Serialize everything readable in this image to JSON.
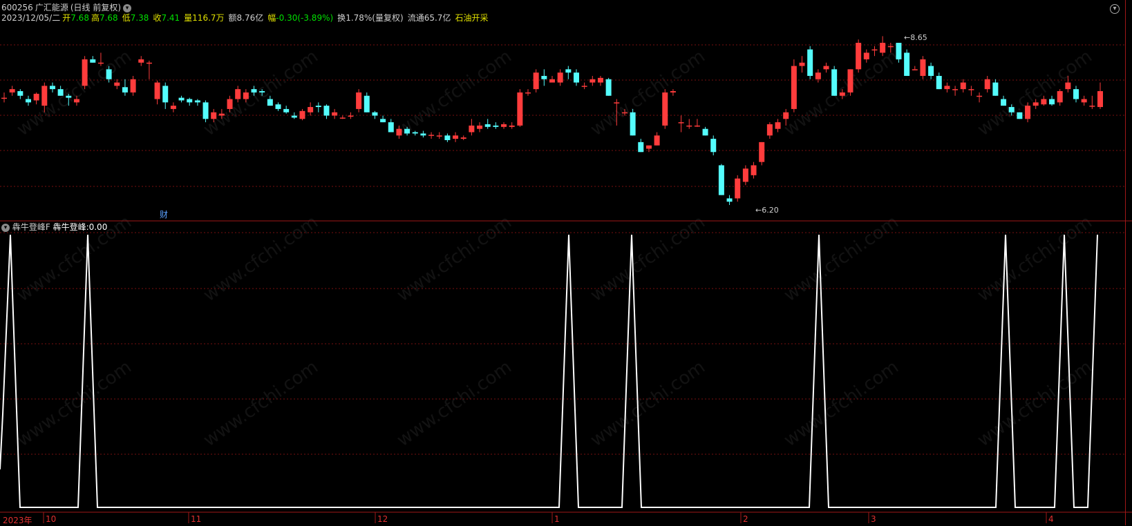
{
  "header": {
    "stock_code": "600256",
    "stock_name": "广汇能源",
    "period_label": "(日线 前复权)",
    "date": "2023/12/05/二",
    "open_label": "开",
    "open": "7.68",
    "high_label": "高",
    "high": "7.68",
    "low_label": "低",
    "low": "7.38",
    "close_label": "收",
    "close": "7.41",
    "volume_label": "量",
    "volume": "116.7万",
    "amount_label": "额",
    "amount": "8.76亿",
    "change_label": "幅",
    "change": "-0.30(-3.89%)",
    "turnover_label": "换",
    "turnover": "1.78%(量复权)",
    "float_label": "流通",
    "float_value": "65.7亿",
    "sector": "石油开采"
  },
  "markers": {
    "high_price": "8.65",
    "low_price": "6.20",
    "finance_tag": "财"
  },
  "indicator": {
    "name": "犇牛登峰F",
    "value_label": "犇牛登峰:",
    "value": "0.00"
  },
  "xaxis": {
    "year": "2023年",
    "months": [
      "10",
      "11",
      "12",
      "1",
      "2",
      "3",
      "4"
    ]
  },
  "watermark": "www.cfchi.com",
  "colors": {
    "up": "#ff3c3c",
    "down": "#54fcfc",
    "grid": "#7a1010",
    "indicator_line": "#ffffff"
  },
  "chart_data": [
    {
      "type": "candlestick",
      "title": "",
      "ylim": [
        6.0,
        9.0
      ],
      "candles": [
        [
          7.82,
          7.9,
          7.75,
          7.82
        ],
        [
          7.9,
          8.0,
          7.85,
          7.95
        ],
        [
          7.92,
          7.95,
          7.8,
          7.85
        ],
        [
          7.8,
          7.85,
          7.7,
          7.75
        ],
        [
          7.78,
          7.9,
          7.72,
          7.88
        ],
        [
          7.7,
          8.05,
          7.6,
          8.0
        ],
        [
          8.0,
          8.05,
          7.9,
          7.95
        ],
        [
          7.95,
          8.0,
          7.85,
          7.85
        ],
        [
          7.85,
          7.88,
          7.7,
          7.82
        ],
        [
          7.75,
          7.85,
          7.7,
          7.8
        ],
        [
          8.0,
          8.45,
          7.95,
          8.4
        ],
        [
          8.4,
          8.45,
          8.35,
          8.35
        ],
        [
          8.35,
          8.5,
          8.3,
          8.35
        ],
        [
          8.25,
          8.3,
          8.05,
          8.1
        ],
        [
          8.0,
          8.1,
          7.95,
          8.05
        ],
        [
          7.98,
          8.1,
          7.85,
          7.9
        ],
        [
          7.9,
          8.15,
          7.85,
          8.1
        ],
        [
          8.35,
          8.45,
          8.3,
          8.4
        ],
        [
          8.35,
          8.38,
          8.1,
          8.35
        ],
        [
          7.8,
          8.08,
          7.72,
          8.05
        ],
        [
          8.0,
          8.05,
          7.65,
          7.75
        ],
        [
          7.65,
          7.75,
          7.6,
          7.7
        ],
        [
          7.82,
          7.85,
          7.75,
          7.78
        ],
        [
          7.8,
          7.82,
          7.7,
          7.75
        ],
        [
          7.78,
          7.8,
          7.7,
          7.75
        ],
        [
          7.75,
          7.78,
          7.45,
          7.5
        ],
        [
          7.5,
          7.65,
          7.45,
          7.6
        ],
        [
          7.55,
          7.65,
          7.5,
          7.58
        ],
        [
          7.65,
          7.85,
          7.6,
          7.8
        ],
        [
          7.8,
          8.0,
          7.75,
          7.95
        ],
        [
          7.8,
          7.95,
          7.75,
          7.9
        ],
        [
          7.95,
          8.0,
          7.85,
          7.9
        ],
        [
          7.92,
          7.95,
          7.85,
          7.9
        ],
        [
          7.8,
          7.85,
          7.7,
          7.7
        ],
        [
          7.72,
          7.75,
          7.62,
          7.65
        ],
        [
          7.65,
          7.7,
          7.58,
          7.6
        ],
        [
          7.55,
          7.6,
          7.5,
          7.52
        ],
        [
          7.5,
          7.65,
          7.48,
          7.62
        ],
        [
          7.6,
          7.75,
          7.55,
          7.68
        ],
        [
          7.7,
          7.75,
          7.6,
          7.68
        ],
        [
          7.7,
          7.72,
          7.5,
          7.55
        ],
        [
          7.55,
          7.65,
          7.5,
          7.6
        ],
        [
          7.52,
          7.55,
          7.5,
          7.52
        ],
        [
          7.55,
          7.6,
          7.5,
          7.55
        ],
        [
          7.65,
          7.95,
          7.6,
          7.9
        ],
        [
          7.85,
          7.9,
          7.6,
          7.6
        ],
        [
          7.6,
          7.62,
          7.5,
          7.55
        ],
        [
          7.5,
          7.55,
          7.45,
          7.45
        ],
        [
          7.45,
          7.5,
          7.3,
          7.3
        ],
        [
          7.25,
          7.4,
          7.2,
          7.35
        ],
        [
          7.35,
          7.38,
          7.25,
          7.28
        ],
        [
          7.3,
          7.32,
          7.25,
          7.28
        ],
        [
          7.28,
          7.32,
          7.22,
          7.25
        ],
        [
          7.25,
          7.3,
          7.2,
          7.26
        ],
        [
          7.25,
          7.3,
          7.2,
          7.25
        ],
        [
          7.25,
          7.28,
          7.15,
          7.18
        ],
        [
          7.2,
          7.3,
          7.15,
          7.25
        ],
        [
          7.2,
          7.25,
          7.18,
          7.22
        ],
        [
          7.3,
          7.5,
          7.25,
          7.4
        ],
        [
          7.35,
          7.45,
          7.3,
          7.4
        ],
        [
          7.42,
          7.5,
          7.35,
          7.38
        ],
        [
          7.4,
          7.45,
          7.35,
          7.38
        ],
        [
          7.38,
          7.45,
          7.35,
          7.42
        ],
        [
          7.38,
          7.45,
          7.35,
          7.4
        ],
        [
          7.4,
          7.95,
          7.38,
          7.9
        ],
        [
          7.9,
          7.95,
          7.85,
          7.9
        ],
        [
          7.95,
          8.25,
          7.9,
          8.2
        ],
        [
          8.15,
          8.25,
          8.0,
          8.1
        ],
        [
          8.05,
          8.15,
          8.05,
          8.1
        ],
        [
          8.05,
          8.25,
          8.0,
          8.2
        ],
        [
          8.25,
          8.3,
          8.1,
          8.2
        ],
        [
          8.2,
          8.25,
          8.0,
          8.05
        ],
        [
          8.0,
          8.05,
          7.95,
          8.0
        ],
        [
          8.05,
          8.15,
          8.0,
          8.1
        ],
        [
          8.05,
          8.15,
          8.0,
          8.12
        ],
        [
          8.1,
          8.12,
          7.85,
          7.85
        ],
        [
          7.75,
          7.8,
          7.4,
          7.75
        ],
        [
          7.6,
          7.65,
          7.55,
          7.6
        ],
        [
          7.6,
          7.65,
          7.25,
          7.25
        ],
        [
          7.15,
          7.2,
          7.0,
          7.0
        ],
        [
          7.05,
          7.1,
          7.0,
          7.1
        ],
        [
          7.1,
          7.3,
          7.1,
          7.25
        ],
        [
          7.4,
          7.95,
          7.35,
          7.9
        ],
        [
          7.9,
          7.95,
          7.85,
          7.92
        ],
        [
          7.45,
          7.55,
          7.3,
          7.45
        ],
        [
          7.4,
          7.5,
          7.35,
          7.4
        ],
        [
          7.4,
          7.5,
          7.38,
          7.4
        ],
        [
          7.35,
          7.38,
          7.25,
          7.25
        ],
        [
          7.2,
          7.25,
          6.95,
          7.0
        ],
        [
          6.8,
          6.82,
          6.35,
          6.35
        ],
        [
          6.3,
          6.35,
          6.2,
          6.25
        ],
        [
          6.3,
          6.65,
          6.25,
          6.6
        ],
        [
          6.55,
          6.8,
          6.5,
          6.75
        ],
        [
          6.65,
          6.85,
          6.6,
          6.8
        ],
        [
          6.85,
          7.15,
          6.8,
          7.15
        ],
        [
          7.25,
          7.45,
          7.2,
          7.42
        ],
        [
          7.35,
          7.5,
          7.3,
          7.45
        ],
        [
          7.5,
          7.65,
          7.4,
          7.6
        ],
        [
          7.65,
          8.4,
          7.6,
          8.3
        ],
        [
          8.3,
          8.45,
          8.2,
          8.35
        ],
        [
          8.55,
          8.6,
          8.1,
          8.15
        ],
        [
          8.1,
          8.25,
          8.05,
          8.2
        ],
        [
          8.25,
          8.35,
          8.2,
          8.3
        ],
        [
          8.25,
          8.3,
          7.85,
          7.85
        ],
        [
          7.85,
          7.95,
          7.8,
          7.9
        ],
        [
          7.9,
          8.25,
          7.85,
          8.25
        ],
        [
          8.25,
          8.7,
          8.2,
          8.65
        ],
        [
          8.4,
          8.55,
          8.35,
          8.5
        ],
        [
          8.55,
          8.6,
          8.45,
          8.55
        ],
        [
          8.5,
          8.75,
          8.45,
          8.65
        ],
        [
          8.6,
          8.65,
          8.5,
          8.6
        ],
        [
          8.65,
          8.62,
          8.35,
          8.4
        ],
        [
          8.5,
          8.55,
          8.15,
          8.15
        ],
        [
          8.25,
          8.3,
          8.25,
          8.25
        ],
        [
          8.15,
          8.45,
          8.1,
          8.4
        ],
        [
          8.3,
          8.35,
          8.1,
          8.15
        ],
        [
          8.15,
          8.2,
          7.95,
          7.95
        ],
        [
          7.95,
          8.05,
          7.9,
          8.0
        ],
        [
          7.95,
          8.0,
          7.85,
          7.95
        ],
        [
          7.95,
          8.1,
          7.9,
          8.05
        ],
        [
          7.95,
          8.0,
          7.85,
          7.95
        ],
        [
          7.85,
          7.9,
          7.75,
          7.85
        ],
        [
          7.95,
          8.15,
          7.9,
          8.1
        ],
        [
          8.05,
          8.1,
          7.85,
          7.85
        ],
        [
          7.8,
          7.85,
          7.7,
          7.7
        ],
        [
          7.68,
          7.72,
          7.55,
          7.6
        ],
        [
          7.6,
          7.6,
          7.5,
          7.5
        ],
        [
          7.5,
          7.75,
          7.45,
          7.7
        ],
        [
          7.7,
          7.8,
          7.65,
          7.75
        ],
        [
          7.72,
          7.85,
          7.7,
          7.8
        ],
        [
          7.8,
          7.85,
          7.7,
          7.72
        ],
        [
          7.75,
          7.95,
          7.7,
          7.92
        ],
        [
          7.95,
          8.15,
          7.9,
          8.05
        ],
        [
          7.95,
          8.0,
          7.75,
          7.8
        ],
        [
          7.75,
          7.85,
          7.7,
          7.8
        ],
        [
          7.7,
          7.85,
          7.65,
          7.7
        ],
        [
          7.68,
          8.05,
          7.65,
          7.92
        ]
      ]
    },
    {
      "type": "line",
      "title": "犇牛登峰F",
      "ylim": [
        0,
        1
      ],
      "series": [
        {
          "values": [
            0,
            1,
            0,
            0,
            0,
            0,
            0,
            0,
            0,
            0,
            0,
            0,
            0,
            0,
            0,
            0,
            0,
            0,
            0,
            0,
            0,
            0,
            0,
            0,
            0,
            0,
            0,
            0,
            0,
            0,
            0,
            0,
            0,
            0,
            0,
            0,
            0,
            0,
            0,
            0,
            0,
            0,
            0,
            0,
            0,
            0,
            0,
            0,
            0,
            0,
            0,
            0,
            0,
            0,
            0,
            0,
            0,
            0,
            0,
            0,
            0,
            0,
            0,
            0,
            0,
            0,
            0,
            0,
            0,
            0,
            0,
            0,
            0,
            0,
            0,
            0,
            0,
            0,
            0,
            0,
            0,
            0,
            0,
            0,
            0,
            0,
            0,
            0,
            0,
            0,
            0,
            0,
            0,
            0,
            0,
            0,
            0,
            0,
            0,
            0,
            0,
            0,
            0,
            0,
            0,
            0,
            0,
            0,
            0,
            0,
            0,
            0,
            0,
            0,
            0,
            0,
            0,
            0,
            0,
            0,
            0,
            0,
            0,
            0,
            0,
            0,
            0,
            0,
            0,
            0,
            0,
            0,
            0,
            0,
            0,
            0,
            0,
            0,
            0,
            0,
            0,
            0,
            0,
            0,
            0,
            0,
            0,
            0,
            0,
            0,
            0,
            0,
            0,
            0,
            0,
            0,
            0,
            0,
            0,
            0,
            0,
            0,
            0,
            0,
            0,
            0,
            0,
            0,
            0,
            0,
            0,
            0,
            0,
            0,
            0,
            0,
            0,
            0,
            0,
            0
          ]
        }
      ],
      "peaks_at_x": [
        15,
        127,
        823,
        914,
        1185,
        1455,
        1540,
        1588
      ]
    }
  ]
}
